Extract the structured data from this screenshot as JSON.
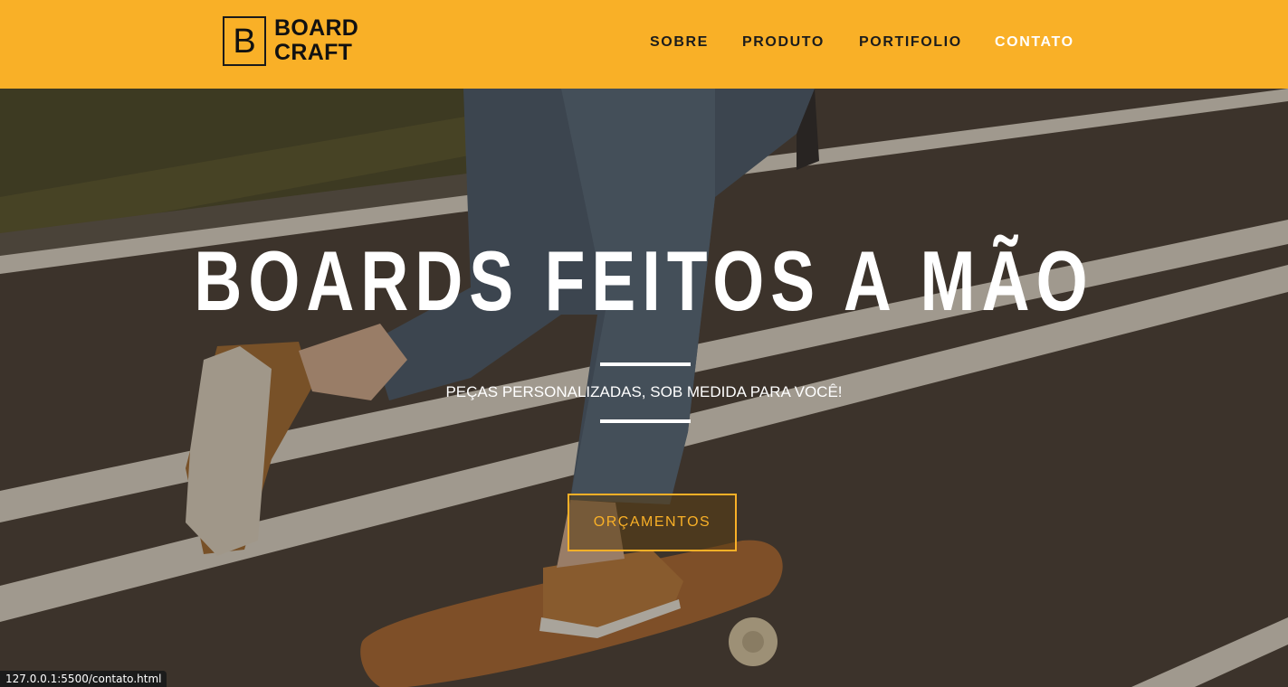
{
  "brand": {
    "logo_letter": "B",
    "line1": "BOARD",
    "line2": "CRAFT",
    "color": "#f9b027"
  },
  "nav": {
    "items": [
      {
        "label": "SOBRE"
      },
      {
        "label": "PRODUTO"
      },
      {
        "label": "PORTIFOLIO"
      },
      {
        "label": "CONTATO",
        "active": true
      }
    ]
  },
  "hero": {
    "title": "BOARDS FEITOS A MÃO",
    "subtitle": "PEÇAS PERSONALIZADAS, SOB MEDIDA PARA VOCÊ!",
    "cta_label": "ORÇAMENTOS",
    "background_icon": "skateboarder-photo"
  },
  "status_bar": {
    "url": "127.0.0.1:5500/contato.html"
  }
}
